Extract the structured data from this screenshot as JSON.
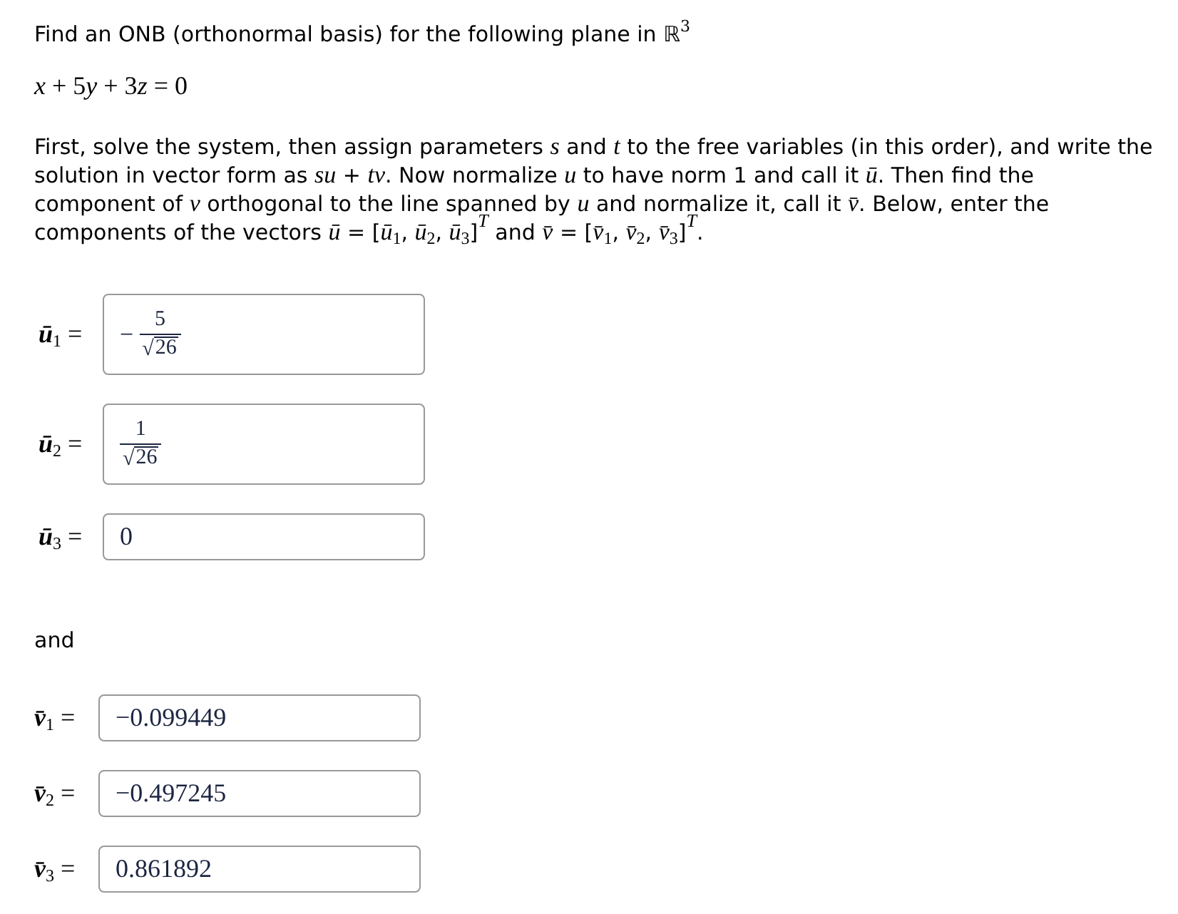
{
  "title": "Find an ONB (orthonormal basis) for the following plane in ℝ$^{3}$",
  "equation": "x + 5y + 3z = 0",
  "instructions": "First, solve the system, then assign parameters *s* and *t* to the free variables (in this order), and write the solution in vector form as *su* + *tv*. Now normalize *u* to have norm 1 and call it *ū*. Then find the component of *v* orthogonal to the line spanned by *u* and normalize it, call it *v̄*. Below, enter the components of the vectors *ū* = [*ū*$_{1}$, *ū*$_{2}$, *ū*$_{3}$]$^{T}$ and *v̄* = [*v̄*$_{1}$, *v̄*$_{2}$, *v̄*$_{3}$]$^{T}$.",
  "u_answers": [
    {
      "label": "*ū*$_{1}$ =",
      "kind": "fraction",
      "sign": "−",
      "numerator": "5",
      "radical": "√",
      "radicand": "26"
    },
    {
      "label": "*ū*$_{2}$ =",
      "kind": "fraction",
      "numerator": "1",
      "radical": "√",
      "radicand": "26"
    },
    {
      "label": "*ū*$_{3}$ =",
      "kind": "number",
      "value": "0"
    }
  ],
  "connector": "and",
  "v_answers": [
    {
      "label": "*v̄*$_{1}$ =",
      "kind": "number",
      "value": "−0.099449"
    },
    {
      "label": "*v̄*$_{2}$ =",
      "kind": "number",
      "value": "−0.497245"
    },
    {
      "label": "*v̄*$_{3}$ =",
      "kind": "number",
      "value": "0.861892"
    }
  ]
}
